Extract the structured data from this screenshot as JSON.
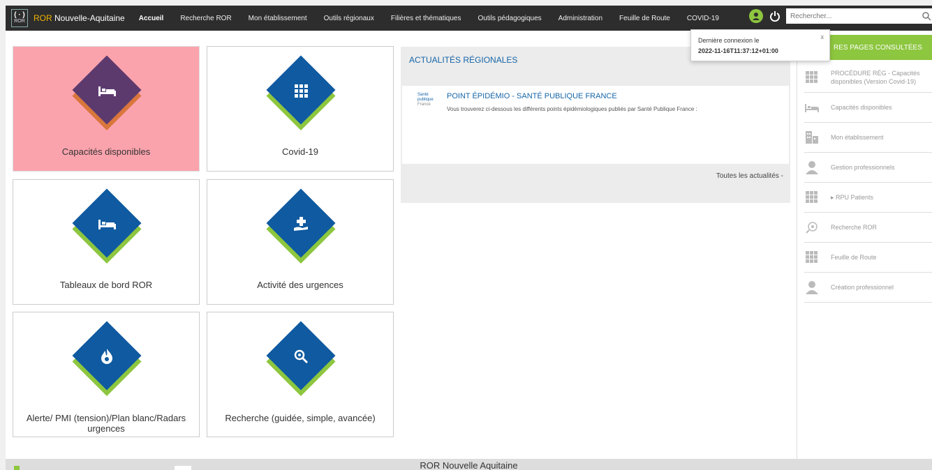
{
  "app": {
    "logo_text": "ROR",
    "brand_prefix": "ROR",
    "brand_name": " Nouvelle-Aquitaine"
  },
  "nav": {
    "items": [
      {
        "label": "Accueil"
      },
      {
        "label": "Recherche ROR"
      },
      {
        "label": "Mon établissement"
      },
      {
        "label": "Outils régionaux"
      },
      {
        "label": "Filières et thématiques"
      },
      {
        "label": "Outils pédagogiques"
      },
      {
        "label": "Administration"
      },
      {
        "label": "Feuille de Route"
      },
      {
        "label": "COVID-19"
      }
    ],
    "active_index": 0
  },
  "search": {
    "placeholder": "Rechercher..."
  },
  "popup": {
    "line1": "Dernière connexion le",
    "line2": "2022-11-16T11:37:12+01:00",
    "close": "x"
  },
  "tiles": [
    {
      "label": "Capacités disponibles",
      "icon": "bed-icon",
      "highlighted": true
    },
    {
      "label": "Covid-19",
      "icon": "grid-icon",
      "highlighted": false
    },
    {
      "label": "Tableaux de bord ROR",
      "icon": "bed-icon",
      "highlighted": false
    },
    {
      "label": "Activité des urgences",
      "icon": "medical-cross-hand-icon",
      "highlighted": false
    },
    {
      "label": "Alerte/ PMI (tension)/Plan blanc/Radars urgences",
      "icon": "fire-icon",
      "highlighted": false
    },
    {
      "label": "Recherche (guidée, simple, avancée)",
      "icon": "magnifier-icon",
      "highlighted": false
    }
  ],
  "news": {
    "title": "ACTUALITÉS RÉGIONALES",
    "item": {
      "logo_line1": "Santé",
      "logo_line2": "publique",
      "logo_line3": "France",
      "title": "POINT ÉPIDÉMIO - SANTÉ PUBLIQUE FRANCE",
      "text": "Vous trouverez ci-dessous les différents points épidémiologiques publiés par Santé Publique France :"
    },
    "all_link": "Toutes les actualités -"
  },
  "sidebar": {
    "header": "RES PAGES CONSULTÉES",
    "items": [
      {
        "label": "PROCÉDURE RÉG - Capacités disponibles (Version Covid-19)",
        "icon": "grid-icon"
      },
      {
        "label": "Capacités disponibles",
        "icon": "bed-icon"
      },
      {
        "label": "Mon établissement",
        "icon": "building-icon"
      },
      {
        "label": "Gestion professionnels",
        "icon": "person-icon"
      },
      {
        "label": "▸ RPU Patients",
        "icon": "grid-icon"
      },
      {
        "label": "Recherche ROR",
        "icon": "magnifier-icon"
      },
      {
        "label": "Feuille de Route",
        "icon": "grid-icon"
      },
      {
        "label": "Création professionnel",
        "icon": "person-icon"
      }
    ]
  },
  "footer": {
    "text": "ROR Nouvelle Aquitaine"
  },
  "colors": {
    "topbar": "#2d2d2d",
    "brand_blue": "#0f5aa0",
    "accent_green": "#8dc63f",
    "highlight_pink": "#fba3ad",
    "highlight_purple": "#5d3a6e",
    "highlight_orange": "#d9763c"
  }
}
